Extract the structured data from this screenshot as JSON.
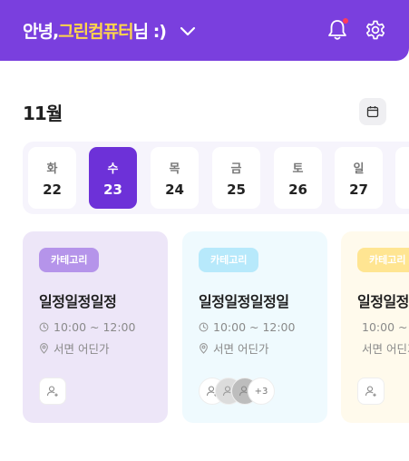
{
  "header": {
    "greeting_prefix": "안녕, ",
    "user_name": "그린컴퓨터",
    "greeting_suffix": "님 :)",
    "accent_color": "#7a3fde",
    "name_color": "#ffd54a",
    "icons": [
      "chevron-down-icon",
      "bell-icon",
      "gear-icon"
    ],
    "has_notification": true
  },
  "calendar": {
    "month_label": "11월",
    "icon": "calendar-icon"
  },
  "week": [
    {
      "dow": "화",
      "num": "22",
      "active": false
    },
    {
      "dow": "수",
      "num": "23",
      "active": true
    },
    {
      "dow": "목",
      "num": "24",
      "active": false
    },
    {
      "dow": "금",
      "num": "25",
      "active": false
    },
    {
      "dow": "토",
      "num": "26",
      "active": false
    },
    {
      "dow": "일",
      "num": "27",
      "active": false
    }
  ],
  "cards": [
    {
      "badge": "카테고리",
      "title": "일정일정일정",
      "time": "10:00 ~ 12:00",
      "location": "서면 어딘가",
      "color": "#ede6f8",
      "more_count": ""
    },
    {
      "badge": "카테고리",
      "title": "일정일정일정일",
      "time": "10:00 ~ 12:00",
      "location": "서면 어딘가",
      "color": "#effafe",
      "more_count": "+3"
    },
    {
      "badge": "카테고리",
      "title": "일정일정",
      "time": "10:00 ~",
      "location": "서면 어딘가",
      "color": "#fffaec",
      "more_count": ""
    }
  ]
}
